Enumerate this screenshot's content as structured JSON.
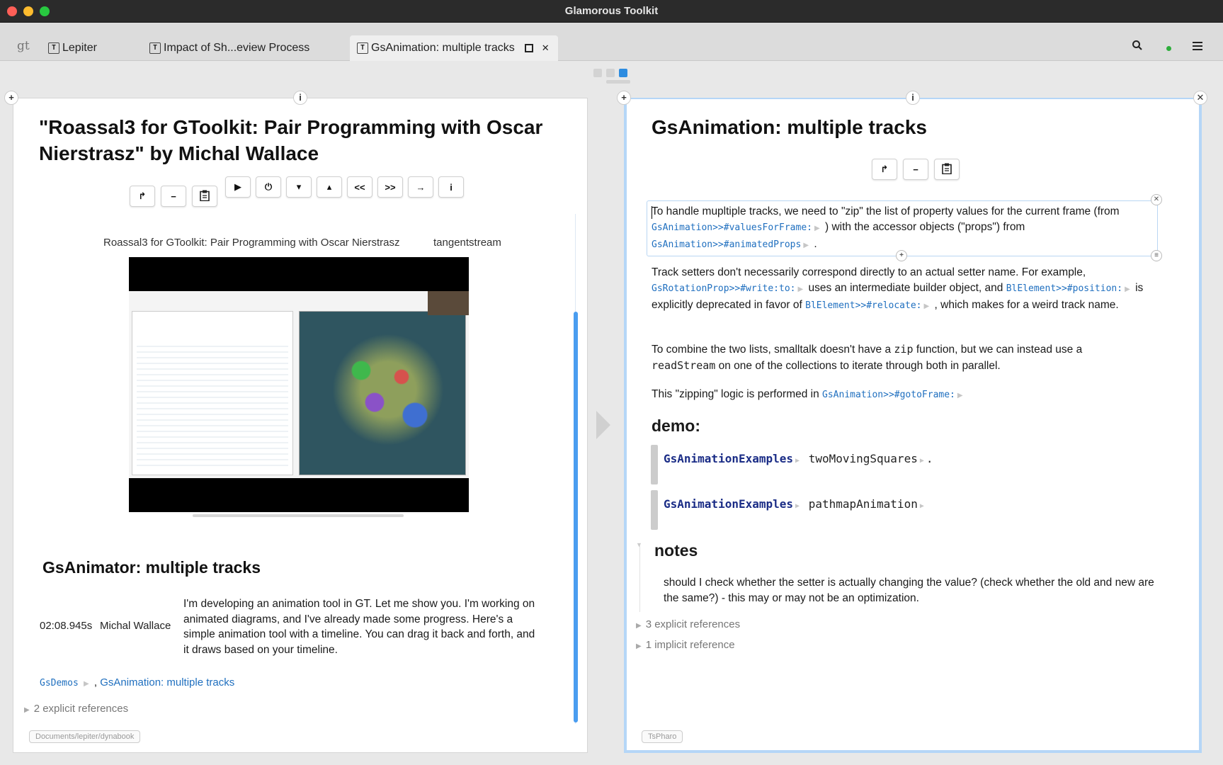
{
  "window": {
    "title": "Glamorous Toolkit"
  },
  "tabs": {
    "logo": "gt",
    "items": [
      {
        "label": "Lepiter"
      },
      {
        "label": "Impact of Sh...eview Process"
      },
      {
        "label": "GsAnimation: multiple tracks"
      }
    ],
    "active_close": "✕"
  },
  "toolbar_icons": {
    "search": "search-icon",
    "status": "status-dot",
    "menu": "menu-icon"
  },
  "colors": {
    "accent": "#2d8ce0",
    "link": "#1f6fbf",
    "pane_focus": "#b5d6f7"
  },
  "left_page": {
    "title": "\"Roassal3 for GToolkit: Pair Programming with Oscar Nierstrasz\" by Michal Wallace",
    "toolbar": {
      "share": "↱",
      "minus": "−",
      "clipboard": "📋"
    },
    "video_controls": {
      "play": "▶",
      "power": "⏻",
      "down": "▾",
      "up": "▴",
      "rewind": "<<",
      "forward": ">>",
      "next": "→",
      "info": "i"
    },
    "video": {
      "caption": "Roassal3 for GToolkit: Pair Programming with Oscar Nierstrasz",
      "author": "tangentstream"
    },
    "section_title": "GsAnimator: multiple tracks",
    "transcript": {
      "time": "02:08.945s",
      "speaker": "Michal Wallace",
      "text": "I'm developing an animation tool in GT. Let me show you. I'm working on animated diagrams, and I've already made some progress. Here's a simple animation tool with a timeline. You can drag it back and forth, and it draws based on your timeline."
    },
    "links": {
      "demos": "GsDemos",
      "separator": ",",
      "page": "GsAnimation: multiple tracks"
    },
    "references": "2 explicit references",
    "path": "Documents/lepiter/dynabook"
  },
  "right_page": {
    "title": "GsAnimation: multiple tracks",
    "toolbar": {
      "share": "↱",
      "minus": "−",
      "clipboard": "📋"
    },
    "p1": {
      "text1": "To handle mupltiple tracks, we need to \"zip\" the list of property values for the current frame (from",
      "ref1": "GsAnimation>>#valuesForFrame:",
      "text2": ") with the accessor objects (\"props\") from",
      "ref2": "GsAnimation>>#animatedProps",
      "text3": "."
    },
    "p2": {
      "text1": "Track setters don't necessarily correspond directly to an actual setter name. For example,",
      "ref1": "GsRotationProp>>#write:to:",
      "text2": "uses an intermediate builder object, and",
      "ref2": "BlElement>>#position:",
      "text3": "is explicitly deprecated in favor of",
      "ref3": "BlElement>>#relocate:",
      "text4": ", which makes for a weird track name."
    },
    "p3": {
      "text1": "To combine the two lists, smalltalk doesn't have a",
      "code1": "zip",
      "text2": "function, but we can instead use a",
      "code2": "readStream",
      "text3": "on one of the collections to iterate through both in parallel."
    },
    "p4": {
      "text1": "This \"zipping\" logic is performed in",
      "ref1": "GsAnimation>>#gotoFrame:"
    },
    "demo_title": "demo:",
    "snippets": [
      {
        "cls": "GsAnimationExamples",
        "msg": "twoMovingSquares",
        "end": "."
      },
      {
        "cls": "GsAnimationExamples",
        "msg": "pathmapAnimation",
        "end": ""
      }
    ],
    "notes_title": "notes",
    "notes_text": "should I check whether the setter is actually changing the value? (check whether the old and new are the same?) - this may or may not be an optimization.",
    "explicit_refs": "3 explicit references",
    "implicit_refs": "1 implicit reference",
    "path": "TsPharo"
  }
}
